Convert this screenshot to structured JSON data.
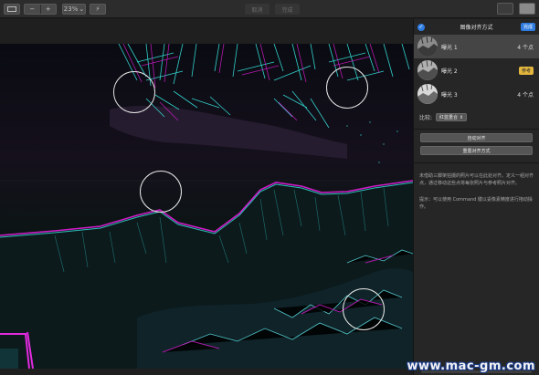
{
  "toolbar": {
    "zoom": "23%",
    "zoom_arrow": "⌄",
    "zoom_out_icon": "−",
    "zoom_in_icon": "+",
    "cancel_label": "取消",
    "done_label": "完成"
  },
  "sidebar": {
    "title": "图像对齐方式",
    "done_button": "完成",
    "layers": [
      {
        "name": "曝光 1",
        "count": "4 个点",
        "selected": true
      },
      {
        "name": "曝光 2",
        "badge": "参考",
        "selected": false
      },
      {
        "name": "曝光 3",
        "count": "4 个点",
        "selected": false
      }
    ],
    "ratio_label": "比较:",
    "ratio_value": "红蓝重合",
    "auto_align_button": "自动对齐",
    "reset_align_button": "重置对齐方式",
    "help_text": "未借助三脚架拍摄的照片可以在此处对齐。定义一组对齐点，通过移动这些点将每张照片与参考照片对齐。",
    "tip_text": "提示：可以使用 Command 键以妥像素精度进行拖动操作。"
  },
  "watermark": "www.mac-gm.com",
  "colors": {
    "accent": "#2f7de1",
    "badge": "#e2b63d",
    "cyan": "#36e7e0",
    "magenta": "#d01cc8"
  }
}
